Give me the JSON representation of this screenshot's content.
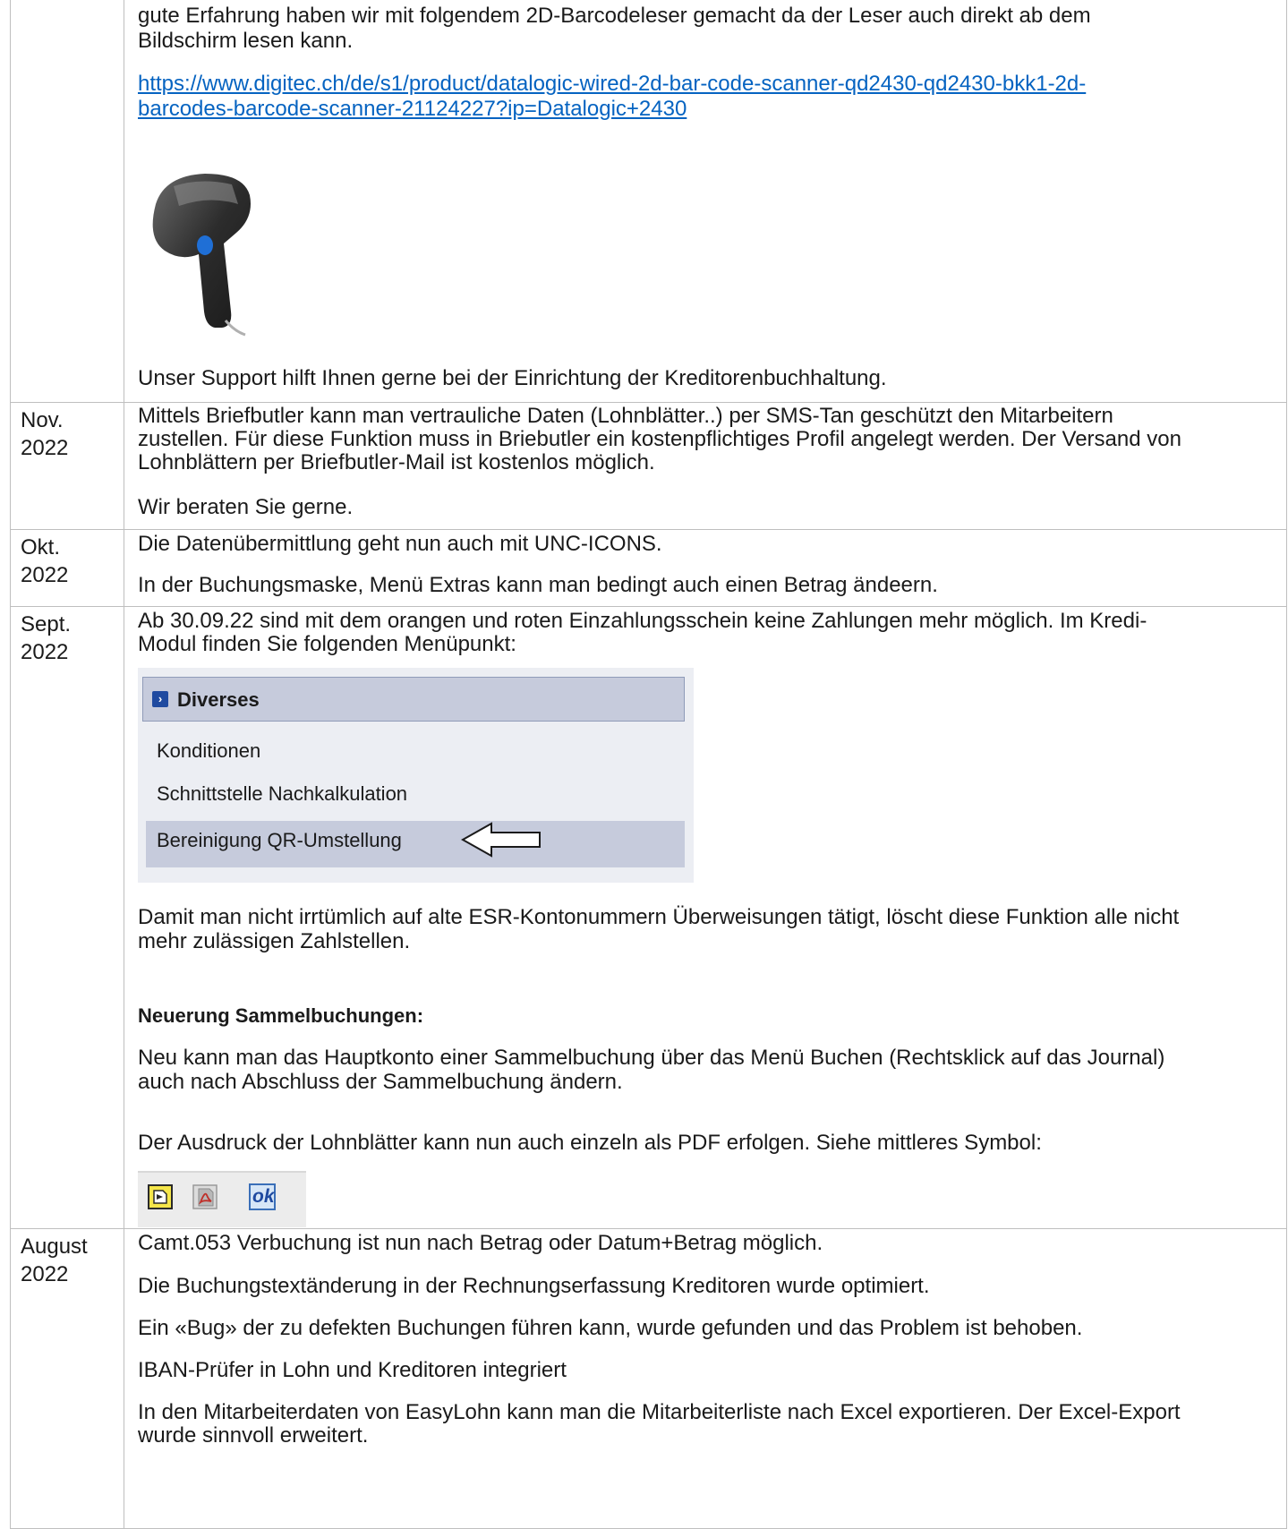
{
  "rows": [
    {
      "date": "",
      "intro": "gute Erfahrung haben wir mit folgendem 2D-Barcodeleser gemacht da der Leser auch direkt ab dem Bildschirm lesen kann.",
      "link": "https://www.digitec.ch/de/s1/product/datalogic-wired-2d-bar-code-scanner-qd2430-qd2430-bkk1-2d-barcodes-barcode-scanner-21124227?ip=Datalogic+2430",
      "link_line1": "https://www.digitec.ch/de/s1/product/datalogic-wired-2d-bar-code-scanner-qd2430-qd2430-bkk1-2d-",
      "link_line2": "barcodes-barcode-scanner-21124227?ip=Datalogic+2430",
      "support": "Unser Support hilft Ihnen gerne bei der Einrichtung der Kreditorenbuchhaltung."
    },
    {
      "date": "Nov.\n2022",
      "p1": "Mittels Briefbutler kann man vertrauliche Daten (Lohnblätter..) per SMS-Tan geschützt den Mitarbeitern zustellen. Für diese Funktion muss in Briebutler ein kostenpflichtiges Profil angelegt werden. Der Versand von Lohnblättern per Briefbutler-Mail ist kostenlos möglich.",
      "p2": "Wir beraten Sie gerne."
    },
    {
      "date": "Okt.\n2022",
      "p1": "Die Datenübermittlung geht nun auch mit UNC-ICONS.",
      "p2": "In der Buchungsmaske, Menü Extras kann man bedingt auch einen Betrag ändeern."
    },
    {
      "date": "Sept.\n2022",
      "p1": "Ab 30.09.22 sind mit dem orangen und roten Einzahlungsschein keine Zahlungen mehr möglich. Im Kredi-Modul finden Sie folgenden Menüpunkt:",
      "menu": {
        "header": "Diverses",
        "items": [
          "Konditionen",
          "Schnittstelle Nachkalkulation",
          "Bereinigung QR-Umstellung"
        ]
      },
      "p2": "Damit man nicht irrtümlich auf alte ESR-Kontonummern Überweisungen tätigt, löscht diese Funktion alle nicht mehr zulässigen Zahlstellen.",
      "heading": "Neuerung Sammelbuchungen:",
      "p3": "Neu kann man das Hauptkonto einer Sammelbuchung über das Menü Buchen (Rechtsklick auf das Journal) auch nach Abschluss der Sammelbuchung ändern.",
      "p4": "Der Ausdruck der Lohnblätter kann nun auch einzeln als PDF erfolgen. Siehe mittleres Symbol:",
      "toolbar_ok": "ok"
    },
    {
      "date": "August\n2022",
      "p1": "Camt.053 Verbuchung ist nun nach Betrag oder Datum+Betrag möglich.",
      "p2": "Die Buchungstextänderung in der Rechnungserfassung Kreditoren wurde optimiert.",
      "p3": "Ein «Bug» der zu defekten Buchungen führen kann, wurde gefunden und das Problem ist behoben.",
      "p4": "IBAN-Prüfer in Lohn und Kreditoren integriert",
      "p5": "In den Mitarbeiterdaten von EasyLohn kann man die Mitarbeiterliste nach Excel exportieren. Der Excel-Export wurde sinnvoll erweitert."
    }
  ]
}
